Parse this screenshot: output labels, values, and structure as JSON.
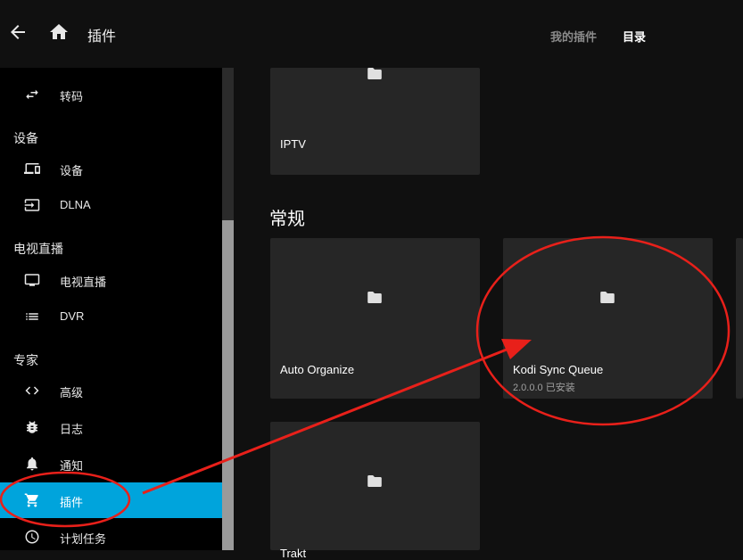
{
  "header": {
    "title": "插件",
    "tabs": [
      {
        "label": "我的插件"
      },
      {
        "label": "目录"
      }
    ]
  },
  "sidebar": {
    "items": [
      {
        "label": "转码",
        "icon": "transcode-icon"
      },
      {
        "heading": "设备"
      },
      {
        "label": "设备",
        "icon": "devices-icon"
      },
      {
        "label": "DLNA",
        "icon": "input-icon"
      },
      {
        "heading": "电视直播"
      },
      {
        "label": "电视直播",
        "icon": "tv-icon"
      },
      {
        "label": "DVR",
        "icon": "list-icon"
      },
      {
        "heading": "专家"
      },
      {
        "label": "高级",
        "icon": "code-icon"
      },
      {
        "label": "日志",
        "icon": "bug-icon"
      },
      {
        "label": "通知",
        "icon": "bell-icon"
      },
      {
        "label": "插件",
        "icon": "cart-icon",
        "active": true
      },
      {
        "label": "计划任务",
        "icon": "clock-icon"
      }
    ]
  },
  "main": {
    "top_card": {
      "title": "IPTV"
    },
    "section_title": "常规",
    "cards": [
      {
        "title": "Auto Organize",
        "subtitle": ""
      },
      {
        "title": "Kodi Sync Queue",
        "subtitle": "2.0.0.0 已安装"
      },
      {
        "title": "Trakt",
        "subtitle": ""
      }
    ]
  },
  "colors": {
    "accent": "#00a4dc",
    "annotation": "#e8201a",
    "card_bg": "#262626",
    "page_bg": "#101010"
  }
}
